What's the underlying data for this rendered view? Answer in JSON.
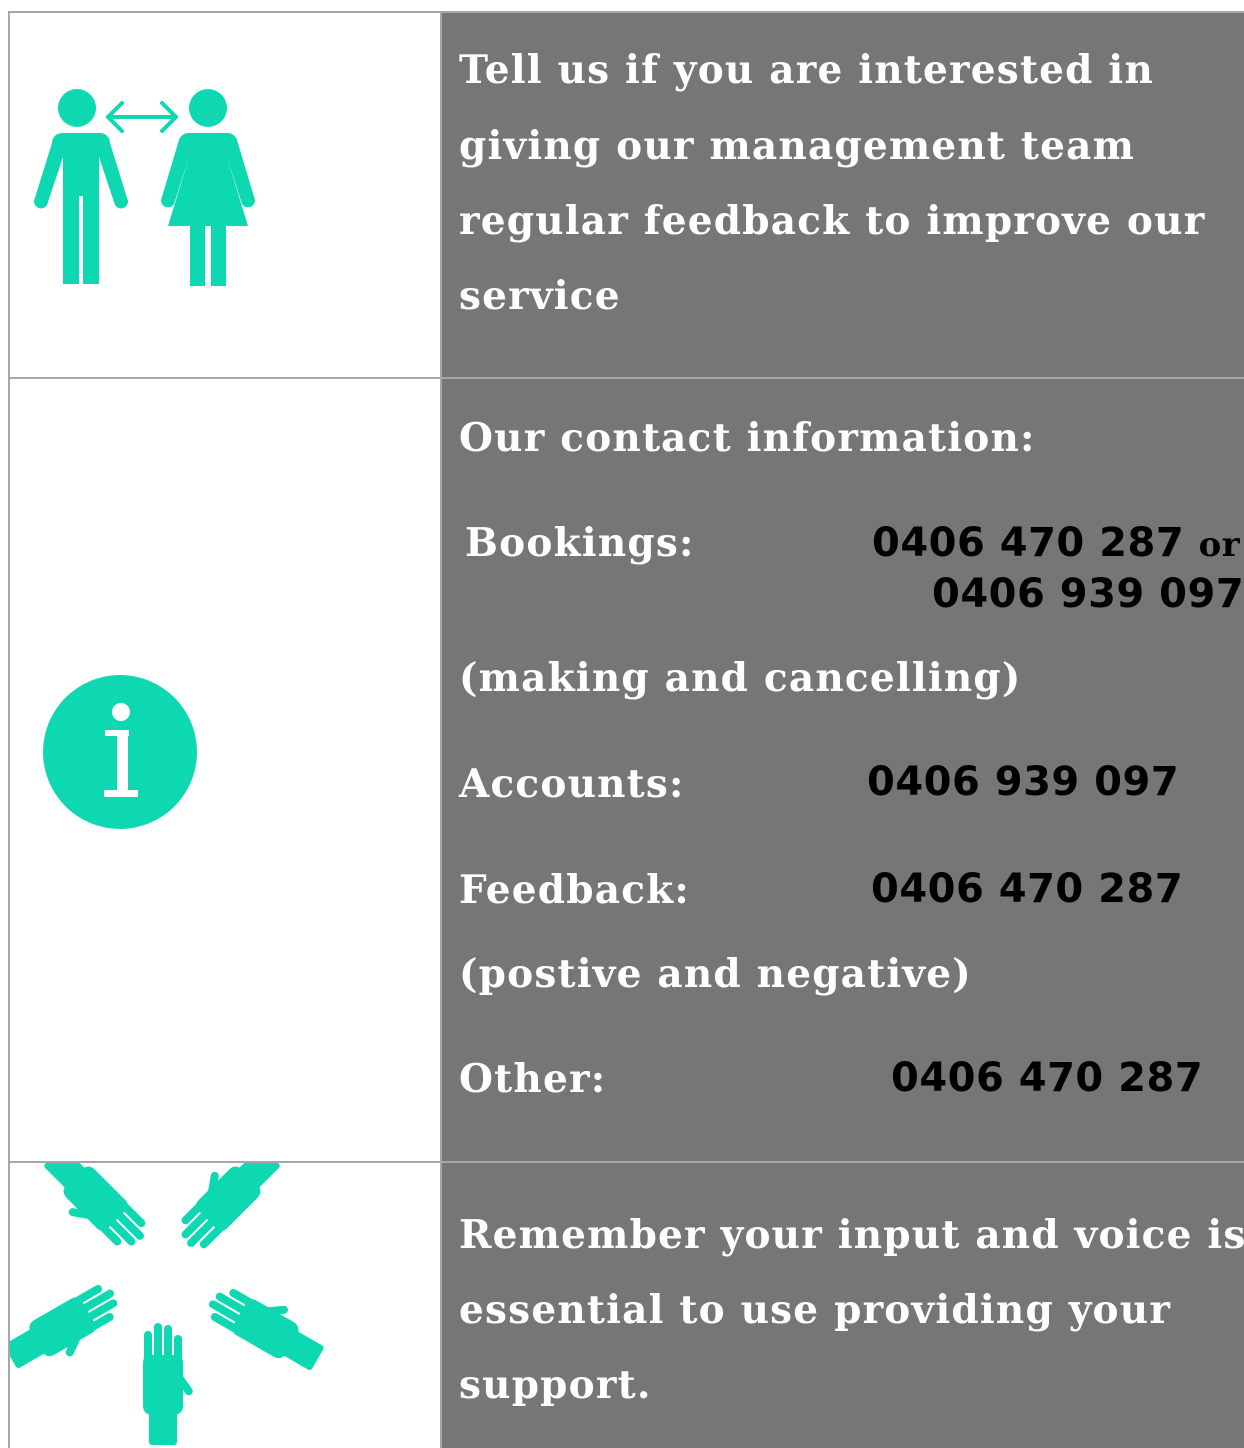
{
  "accent_color": "#0dd8b1",
  "panel_color": "#767676",
  "rows": [
    {
      "icon": "man-woman-arrow-icon",
      "lines": [
        "Tell us if you are interested in",
        "giving our management team",
        "regular feedback to improve our",
        "service"
      ]
    },
    {
      "icon": "info-icon",
      "heading": "Our contact information:",
      "bookings_label": "Bookings:",
      "bookings_number_1": "0406 470 287",
      "bookings_or": "or",
      "bookings_number_2": "0406 939 097",
      "bookings_note": "(making and cancelling)",
      "accounts_label": "Accounts:",
      "accounts_number": "0406 939 097",
      "feedback_label": "Feedback:",
      "feedback_number": "0406 470 287",
      "feedback_note": "(postive and negative)",
      "other_label": "Other:",
      "other_number": "0406 470 287"
    },
    {
      "icon": "hands-circle-icon",
      "lines": [
        "Remember your input and voice is",
        "essential to use providing your",
        "support."
      ]
    }
  ]
}
